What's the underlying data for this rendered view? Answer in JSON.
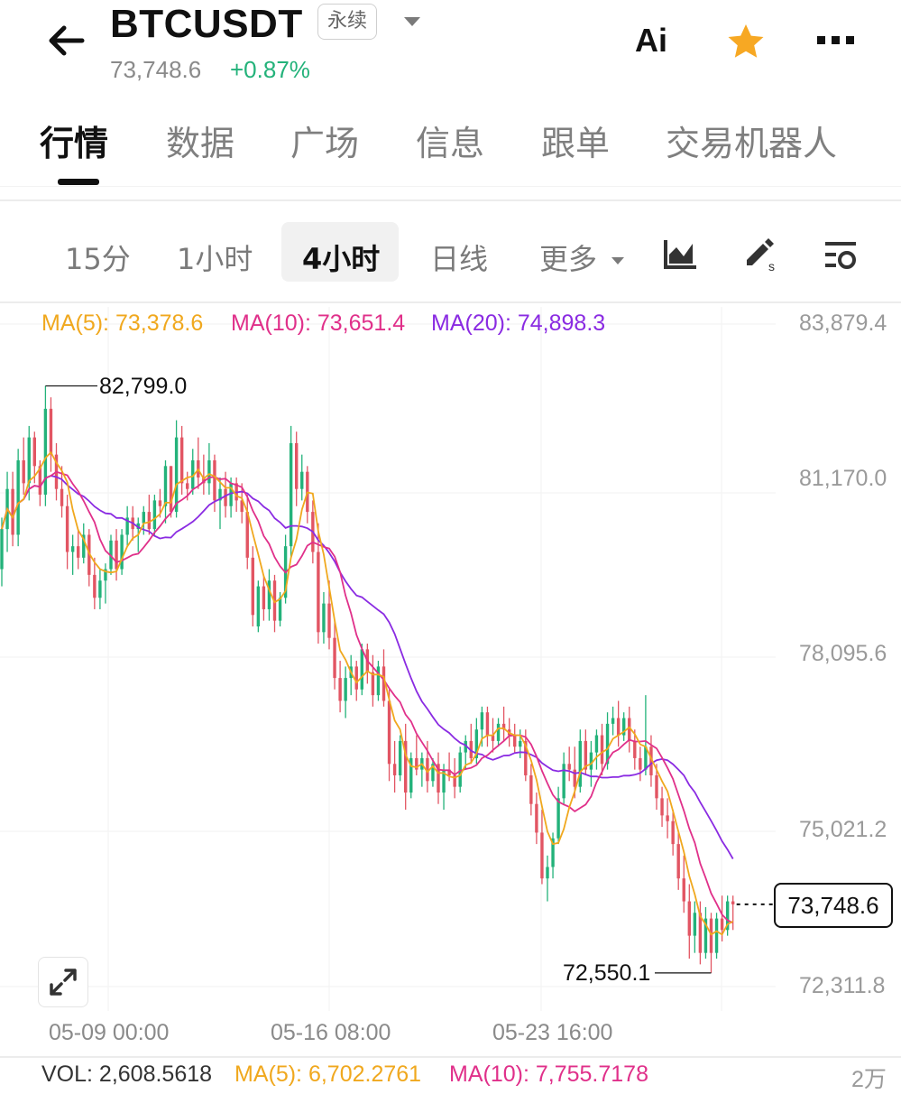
{
  "header": {
    "symbol": "BTCUSDT",
    "contract_type": "永续",
    "last_price": "73,748.6",
    "change_pct": "+0.87%",
    "ai_label": "Ai",
    "icons": [
      "back-arrow-icon",
      "dropdown-caret-icon",
      "star-icon",
      "more-dots-icon"
    ],
    "accent_up": "#23b27a",
    "accent_down": "#e25563",
    "favorite_color": "#f7a823"
  },
  "main_tabs": [
    {
      "label": "行情",
      "active": true
    },
    {
      "label": "数据",
      "active": false
    },
    {
      "label": "广场",
      "active": false
    },
    {
      "label": "信息",
      "active": false
    },
    {
      "label": "跟单",
      "active": false
    },
    {
      "label": "交易机器人",
      "active": false
    }
  ],
  "intervals": [
    {
      "label": "15分",
      "active": false
    },
    {
      "label": "1小时",
      "active": false
    },
    {
      "label": "4小时",
      "active": true
    },
    {
      "label": "日线",
      "active": false
    },
    {
      "label": "更多",
      "active": false
    }
  ],
  "tools": [
    "chart-type-icon",
    "draw-tool-icon",
    "indicator-settings-icon"
  ],
  "ma_legend": {
    "ma5": "MA(5): 73,378.6",
    "ma10": "MA(10): 73,651.4",
    "ma20": "MA(20): 74,898.3",
    "colors": {
      "ma5": "#f0a81e",
      "ma10": "#e0308a",
      "ma20": "#8a2be2"
    }
  },
  "chart_data": {
    "type": "candlestick",
    "y_ticks": [
      "83,879.4",
      "81,170.0",
      "78,095.6",
      "75,021.2",
      "72,311.8"
    ],
    "x_ticks": [
      "05-09 00:00",
      "05-16 08:00",
      "05-23 16:00"
    ],
    "high_marker": "82,799.0",
    "low_marker": "72,550.1",
    "current_price": "73,748.6",
    "candles": [
      [
        79600,
        80500,
        79300,
        80300
      ],
      [
        80300,
        81300,
        79900,
        81000
      ],
      [
        81000,
        81300,
        80000,
        80200
      ],
      [
        80200,
        81700,
        80000,
        81500
      ],
      [
        81500,
        81900,
        80900,
        81100
      ],
      [
        81100,
        82100,
        80800,
        81900
      ],
      [
        81900,
        82000,
        81100,
        81400
      ],
      [
        81400,
        81500,
        80700,
        80900
      ],
      [
        80900,
        82799,
        80700,
        82400
      ],
      [
        82400,
        82600,
        81300,
        81600
      ],
      [
        81600,
        81800,
        80800,
        81000
      ],
      [
        81000,
        81400,
        80500,
        80700
      ],
      [
        80700,
        80900,
        79600,
        79900
      ],
      [
        79900,
        80200,
        79500,
        80000
      ],
      [
        80000,
        80300,
        79600,
        79800
      ],
      [
        79800,
        80400,
        79700,
        80200
      ],
      [
        80200,
        80300,
        79300,
        79500
      ],
      [
        79500,
        79800,
        78900,
        79100
      ],
      [
        79100,
        79600,
        78900,
        79400
      ],
      [
        79400,
        79700,
        79000,
        79600
      ],
      [
        79600,
        80200,
        79500,
        80100
      ],
      [
        80100,
        80300,
        79400,
        79600
      ],
      [
        79600,
        80300,
        79500,
        80200
      ],
      [
        80200,
        80700,
        80000,
        80500
      ],
      [
        80500,
        80700,
        80100,
        80300
      ],
      [
        80300,
        80500,
        79900,
        80400
      ],
      [
        80400,
        80700,
        80200,
        80600
      ],
      [
        80600,
        80900,
        80200,
        80300
      ],
      [
        80300,
        80900,
        80200,
        80800
      ],
      [
        80800,
        81000,
        80500,
        80700
      ],
      [
        80700,
        81500,
        80400,
        81400
      ],
      [
        81400,
        81400,
        80500,
        80600
      ],
      [
        80600,
        82200,
        80500,
        81900
      ],
      [
        81900,
        82100,
        80900,
        81100
      ],
      [
        81100,
        81300,
        80800,
        81000
      ],
      [
        81000,
        81700,
        80900,
        81500
      ],
      [
        81500,
        81900,
        81000,
        81200
      ],
      [
        81200,
        81600,
        80900,
        81100
      ],
      [
        81100,
        81800,
        80900,
        81500
      ],
      [
        81500,
        81600,
        80600,
        80800
      ],
      [
        80800,
        81200,
        80300,
        81000
      ],
      [
        81000,
        81300,
        80500,
        80700
      ],
      [
        80700,
        81200,
        80500,
        81100
      ],
      [
        81100,
        81200,
        80600,
        80800
      ],
      [
        80800,
        81100,
        80400,
        80600
      ],
      [
        80600,
        80900,
        79600,
        79800
      ],
      [
        79800,
        80000,
        78600,
        78800
      ],
      [
        78600,
        79400,
        78500,
        79300
      ],
      [
        79300,
        79500,
        78700,
        78900
      ],
      [
        78900,
        79600,
        78700,
        79400
      ],
      [
        79400,
        79500,
        78500,
        78700
      ],
      [
        78700,
        79200,
        78600,
        79100
      ],
      [
        79100,
        80200,
        79000,
        80000
      ],
      [
        80000,
        82100,
        79800,
        81800
      ],
      [
        81800,
        82000,
        80700,
        81000
      ],
      [
        81000,
        81600,
        80800,
        81300
      ],
      [
        81300,
        81400,
        80400,
        80600
      ],
      [
        80600,
        80800,
        79700,
        79900
      ],
      [
        79900,
        80400,
        78300,
        78500
      ],
      [
        78500,
        79200,
        78300,
        79000
      ],
      [
        79000,
        79400,
        78200,
        78400
      ],
      [
        78400,
        78700,
        77500,
        77700
      ],
      [
        77700,
        78000,
        77100,
        77300
      ],
      [
        77300,
        77900,
        77000,
        77700
      ],
      [
        77700,
        78100,
        77400,
        77900
      ],
      [
        77900,
        78000,
        77300,
        77500
      ],
      [
        77500,
        78300,
        77400,
        78200
      ],
      [
        78200,
        78300,
        77600,
        77800
      ],
      [
        77800,
        78100,
        77200,
        77400
      ],
      [
        77400,
        78000,
        77300,
        77900
      ],
      [
        77900,
        78200,
        77200,
        77300
      ],
      [
        77300,
        77500,
        75900,
        76200
      ],
      [
        76200,
        76600,
        75700,
        76000
      ],
      [
        76000,
        76700,
        75900,
        76600
      ],
      [
        76600,
        76900,
        75400,
        75700
      ],
      [
        75700,
        76400,
        75600,
        76300
      ],
      [
        76300,
        76700,
        76000,
        76100
      ],
      [
        76100,
        76400,
        75800,
        76300
      ],
      [
        76300,
        76600,
        75700,
        75900
      ],
      [
        75900,
        76300,
        75800,
        76200
      ],
      [
        76200,
        76400,
        75500,
        75700
      ],
      [
        75700,
        76200,
        75400,
        76100
      ],
      [
        76100,
        76400,
        75900,
        76000
      ],
      [
        76000,
        76300,
        75600,
        75800
      ],
      [
        75800,
        76500,
        75700,
        76400
      ],
      [
        76400,
        76700,
        76100,
        76600
      ],
      [
        76600,
        76900,
        76200,
        76300
      ],
      [
        76300,
        77000,
        76200,
        76800
      ],
      [
        76800,
        77200,
        76500,
        77100
      ],
      [
        77100,
        77200,
        76500,
        76700
      ],
      [
        76700,
        77000,
        76400,
        76600
      ],
      [
        76600,
        77000,
        76500,
        76900
      ],
      [
        76900,
        77200,
        76600,
        76800
      ],
      [
        76800,
        77000,
        76500,
        76700
      ],
      [
        76700,
        76900,
        76400,
        76500
      ],
      [
        76500,
        76800,
        76300,
        76600
      ],
      [
        76600,
        76800,
        75900,
        76000
      ],
      [
        76000,
        76200,
        75300,
        75500
      ],
      [
        75500,
        75700,
        74800,
        75000
      ],
      [
        75000,
        75400,
        74100,
        74200
      ],
      [
        74200,
        74600,
        73800,
        74400
      ],
      [
        74400,
        75000,
        74200,
        74900
      ],
      [
        74900,
        75800,
        74800,
        75600
      ],
      [
        75600,
        76400,
        75500,
        76200
      ],
      [
        76200,
        76500,
        75900,
        76100
      ],
      [
        76100,
        76500,
        75600,
        75800
      ],
      [
        75800,
        76800,
        75700,
        76600
      ],
      [
        76600,
        76800,
        76000,
        76100
      ],
      [
        76100,
        76600,
        75800,
        76400
      ],
      [
        76400,
        76800,
        76100,
        76700
      ],
      [
        76700,
        76900,
        76000,
        76200
      ],
      [
        76200,
        77100,
        76100,
        76900
      ],
      [
        76900,
        77200,
        76700,
        77000
      ],
      [
        77000,
        77300,
        76500,
        76700
      ],
      [
        76700,
        77100,
        76600,
        77000
      ],
      [
        77000,
        77200,
        76400,
        76600
      ],
      [
        76600,
        76800,
        76100,
        76300
      ],
      [
        76300,
        76500,
        75900,
        76100
      ],
      [
        76100,
        77400,
        76000,
        76500
      ],
      [
        76500,
        76700,
        75800,
        76000
      ],
      [
        76000,
        76200,
        75400,
        75600
      ],
      [
        75600,
        75800,
        75100,
        75300
      ],
      [
        75300,
        75600,
        74900,
        75200
      ],
      [
        75200,
        75400,
        74600,
        74800
      ],
      [
        74800,
        75000,
        74000,
        74200
      ],
      [
        74200,
        74600,
        73600,
        73800
      ],
      [
        73800,
        74100,
        72800,
        73200
      ],
      [
        73200,
        73800,
        72900,
        73600
      ],
      [
        73600,
        73800,
        72700,
        72900
      ],
      [
        72900,
        73700,
        72800,
        73500
      ],
      [
        73500,
        73600,
        72550,
        72900
      ],
      [
        72900,
        73600,
        72800,
        73500
      ],
      [
        73500,
        73900,
        73100,
        73300
      ],
      [
        73300,
        73900,
        73200,
        73800
      ],
      [
        73800,
        73900,
        73300,
        73748
      ]
    ]
  },
  "volume": {
    "vol": "VOL: 2,608.5618",
    "ma5": "MA(5): 6,702.2761",
    "ma10": "MA(10): 7,755.7178",
    "scale": "2万"
  }
}
